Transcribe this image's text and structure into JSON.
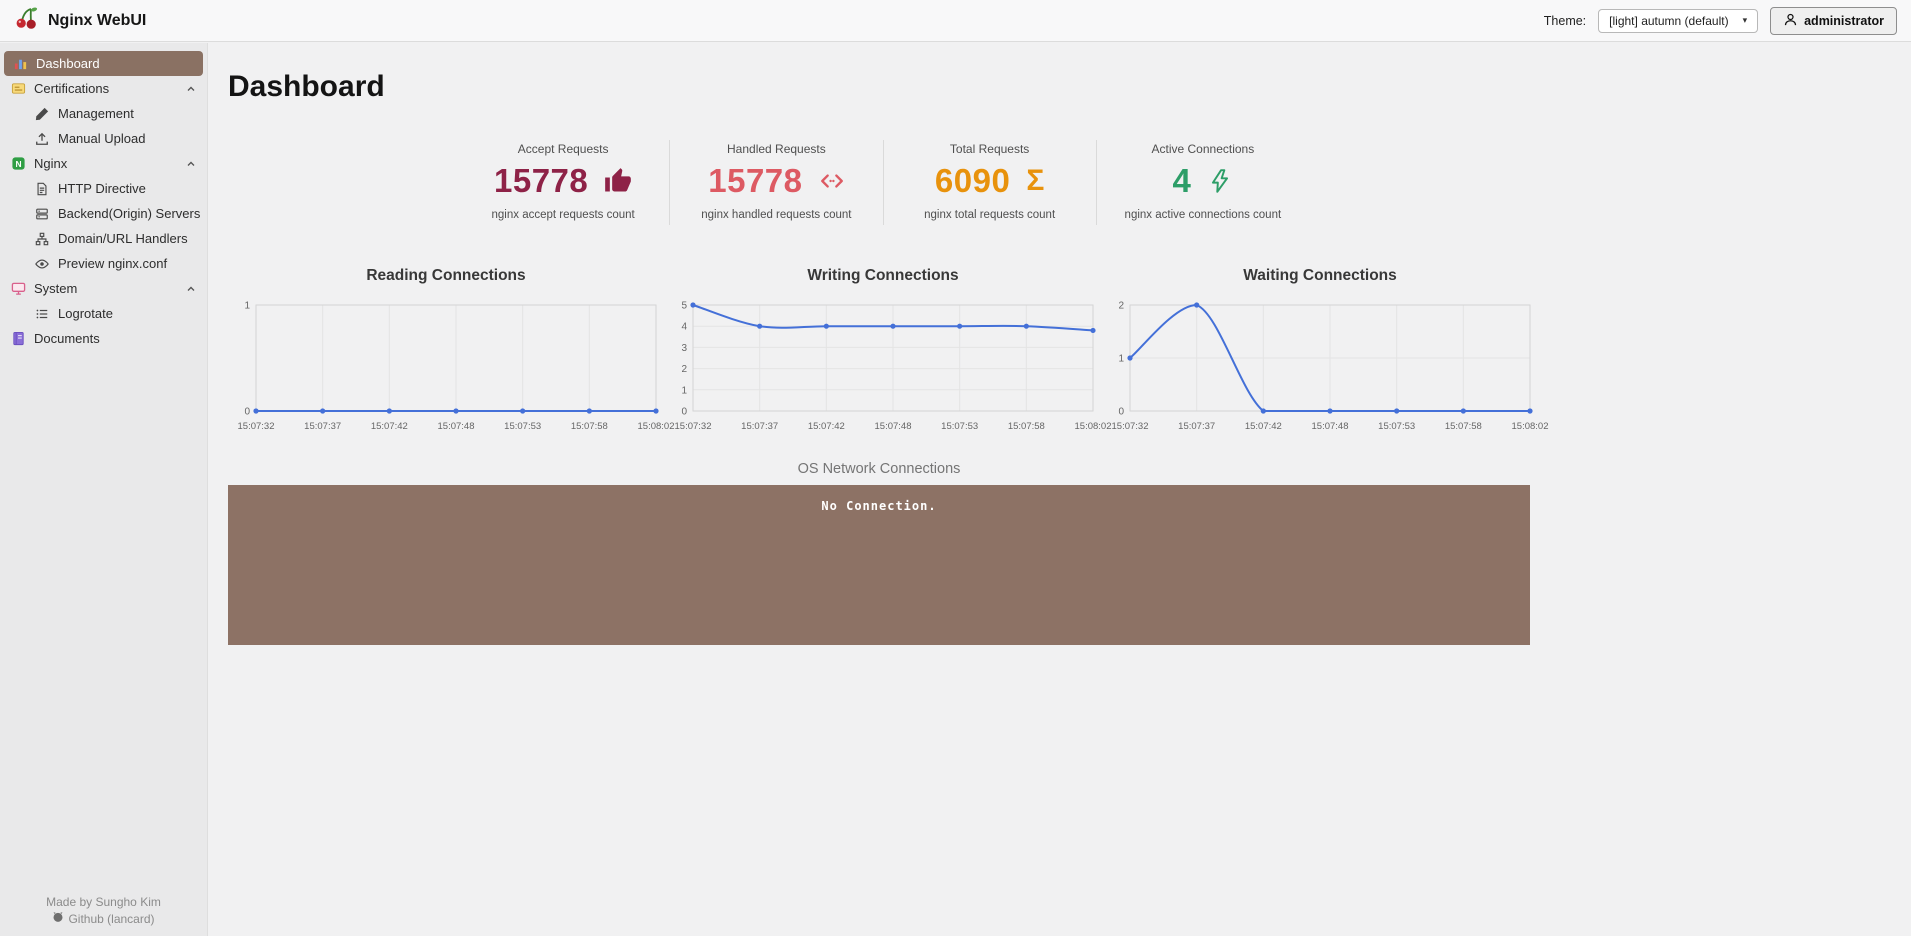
{
  "header": {
    "app_title": "Nginx WebUI",
    "theme_label": "Theme:",
    "theme_select_value": "[light] autumn (default)",
    "user_name": "administrator"
  },
  "icons": {
    "caret_down": "▾",
    "sigma": "Σ"
  },
  "sidebar": {
    "items": [
      {
        "label": "Dashboard"
      },
      {
        "label": "Certifications"
      },
      {
        "label": "Management"
      },
      {
        "label": "Manual Upload"
      },
      {
        "label": "Nginx"
      },
      {
        "label": "HTTP Directive"
      },
      {
        "label": "Backend(Origin) Servers"
      },
      {
        "label": "Domain/URL Handlers"
      },
      {
        "label": "Preview nginx.conf"
      },
      {
        "label": "System"
      },
      {
        "label": "Logrotate"
      },
      {
        "label": "Documents"
      }
    ],
    "footer_line1": "Made by Sungho Kim",
    "footer_line2": "Github (lancard)"
  },
  "main": {
    "page_title": "Dashboard",
    "stats": [
      {
        "label": "Accept Requests",
        "value": "15778",
        "caption": "nginx accept requests count",
        "color": "#8e2247"
      },
      {
        "label": "Handled Requests",
        "value": "15778",
        "caption": "nginx handled requests count",
        "color": "#dd5a63"
      },
      {
        "label": "Total Requests",
        "value": "6090",
        "caption": "nginx total requests count",
        "color": "#e8920c"
      },
      {
        "label": "Active Connections",
        "value": "4",
        "caption": "nginx active connections count",
        "color": "#2d9e68"
      }
    ],
    "os_connections_title": "OS Network Connections",
    "no_connection_message": "No Connection."
  },
  "chart_data": [
    {
      "type": "line",
      "title": "Reading Connections",
      "x": [
        "15:07:32",
        "15:07:37",
        "15:07:42",
        "15:07:48",
        "15:07:53",
        "15:07:58",
        "15:08:02"
      ],
      "values": [
        0,
        0,
        0,
        0,
        0,
        0,
        0
      ],
      "ylim": [
        0,
        1
      ],
      "yticks": [
        0,
        1
      ],
      "line_color": "#4470d8",
      "grid": true,
      "legend": "none"
    },
    {
      "type": "line",
      "title": "Writing Connections",
      "x": [
        "15:07:32",
        "15:07:37",
        "15:07:42",
        "15:07:48",
        "15:07:53",
        "15:07:58",
        "15:08:02"
      ],
      "values": [
        5,
        4,
        4,
        4,
        4,
        4,
        3.8
      ],
      "ylim": [
        0,
        5
      ],
      "yticks": [
        0,
        1,
        2,
        3,
        4,
        5
      ],
      "line_color": "#4470d8",
      "grid": true,
      "legend": "none"
    },
    {
      "type": "line",
      "title": "Waiting Connections",
      "x": [
        "15:07:32",
        "15:07:37",
        "15:07:42",
        "15:07:48",
        "15:07:53",
        "15:07:58",
        "15:08:02"
      ],
      "values": [
        1,
        2,
        0,
        0,
        0,
        0,
        0
      ],
      "ylim": [
        0,
        2
      ],
      "yticks": [
        0,
        1,
        2
      ],
      "line_color": "#4470d8",
      "grid": true,
      "legend": "none"
    }
  ]
}
